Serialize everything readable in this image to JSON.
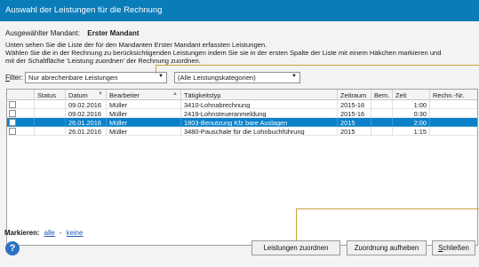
{
  "window": {
    "title": "Auswahl der Leistungen für die Rechnung"
  },
  "mandant": {
    "label": "Ausgewählter Mandant:",
    "value": "Erster Mandant"
  },
  "info": {
    "line1": "Unten sehen Sie die Liste der für den Mandanten Erster Mandant erfassten Leistungen.",
    "line2": "Wählen Sie die in der Rechnung zu berücksichtigenden Leistungen indem Sie sie in der ersten Spalte der Liste mit einem Häkchen markieren und",
    "line3": "mit der Schaltfläche 'Leistung zuordnen' der Rechnung zuordnen."
  },
  "filter": {
    "label_first": "F",
    "label_rest": "ilter:",
    "selected": "Nur abrechenbare Leistungen",
    "category": "(Alle Leistungskategorien)"
  },
  "table": {
    "columns": [
      "Status",
      "Datum",
      "Bearbeiter",
      "Tätigkeitstyp",
      "Zeitraum",
      "Bem.",
      "Zeit",
      "Rechn.-Nr."
    ],
    "rows": [
      {
        "status": "",
        "datum": "09.02.2016",
        "bearbeiter": "Müller",
        "taetigkeit": "3410-Lohnabrechnung",
        "zeitraum": "2015-16",
        "bem": "",
        "zeit": "1:00",
        "rechnr": ""
      },
      {
        "status": "",
        "datum": "09.02.2016",
        "bearbeiter": "Müller",
        "taetigkeit": "2419-Lohnsteueranmeldung",
        "zeitraum": "2015-16",
        "bem": "",
        "zeit": "0:30",
        "rechnr": ""
      },
      {
        "status": "",
        "datum": "26.01.2016",
        "bearbeiter": "Müller",
        "taetigkeit": "1803-Benutzung Kfz bare Auslagen",
        "zeitraum": "2015",
        "bem": "",
        "zeit": "2:00",
        "rechnr": ""
      },
      {
        "status": "",
        "datum": "26.01.2016",
        "bearbeiter": "Müller",
        "taetigkeit": "3480-Pauschale für die Lohnbuchführung",
        "zeitraum": "2015",
        "bem": "",
        "zeit": "1:15",
        "rechnr": ""
      }
    ]
  },
  "mark": {
    "label": "Markieren:",
    "all": "alle",
    "sep": "-",
    "none": "keine"
  },
  "buttons": {
    "assign": "Leistungen zuordnen",
    "unassign": "Zuordnung aufheben",
    "close_first": "S",
    "close_rest": "chließen"
  },
  "colors": {
    "titlebar": "#0a7cb8",
    "selection": "#0a80c8",
    "callout": "#c8a23a"
  }
}
